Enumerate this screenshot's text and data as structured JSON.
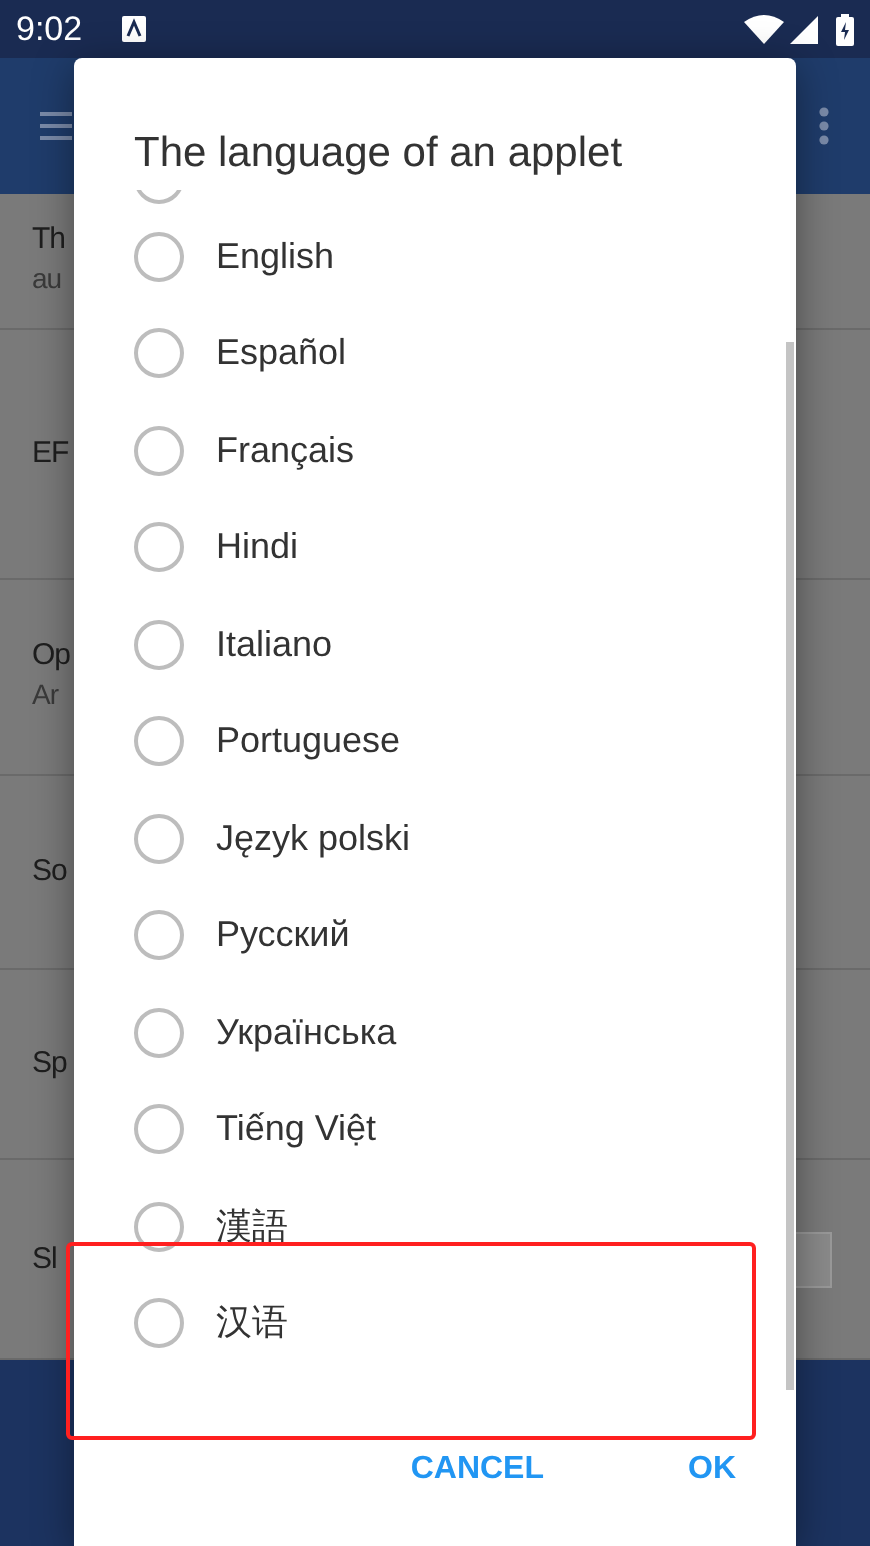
{
  "status_bar": {
    "time": "9:02"
  },
  "background_rows": [
    {
      "title": "Th",
      "subtitle": "au"
    },
    {
      "title": "EF"
    },
    {
      "title": "Op",
      "subtitle": "Ar"
    },
    {
      "title": "So"
    },
    {
      "title": "Sp"
    },
    {
      "title": "Sl",
      "kind": "field"
    }
  ],
  "dialog": {
    "title": "The language of an applet",
    "options": [
      {
        "label": "English",
        "selected": false
      },
      {
        "label": "Español",
        "selected": false
      },
      {
        "label": "Français",
        "selected": false
      },
      {
        "label": "Hindi",
        "selected": false
      },
      {
        "label": "Italiano",
        "selected": false
      },
      {
        "label": "Portuguese",
        "selected": false
      },
      {
        "label": "Język polski",
        "selected": false
      },
      {
        "label": "Русский",
        "selected": false
      },
      {
        "label": "Українська",
        "selected": false
      },
      {
        "label": "Tiếng Việt",
        "selected": false
      },
      {
        "label": "漢語",
        "selected": false
      },
      {
        "label": "汉语",
        "selected": false
      }
    ],
    "buttons": [
      "CANCEL",
      "OK"
    ]
  },
  "highlight_frame": true
}
